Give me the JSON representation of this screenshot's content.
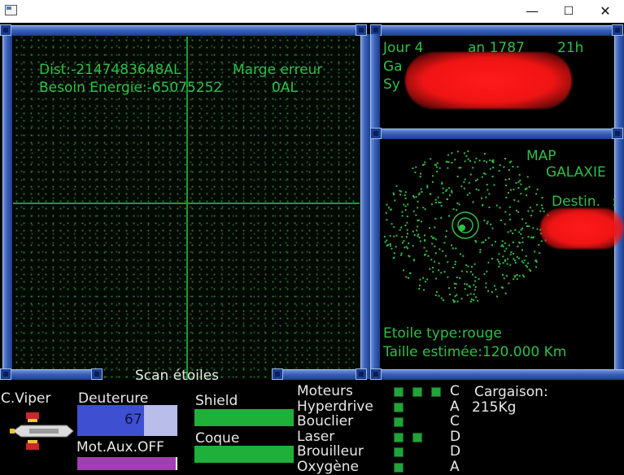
{
  "window": {
    "minimize_label": "—",
    "maximize_label": "☐",
    "close_label": "✕"
  },
  "scanner": {
    "dist_label": "Dist:-2147483648AL",
    "margin_label": "Marge erreur",
    "energy_label": "Besoin Energie:-65075252",
    "energy_unit": "0AL",
    "title": "Scan étoiles"
  },
  "info_panel": {
    "day_label": "Jour 4",
    "year_label": "an 1787",
    "hour_label": "21h",
    "galaxy_prefix": "Ga",
    "system_prefix": "Sy"
  },
  "map_panel": {
    "title_line1": "MAP",
    "title_line2": "GALAXIE",
    "destination_label": "Destin.",
    "destination_suffix": ":",
    "star_type_label": "Etoile type:rouge",
    "size_label": "Taille estimée:120.000 Km"
  },
  "ship": {
    "name": "C.Viper",
    "deuterium_label": "Deuterure",
    "deuterium_value": "67",
    "deuterium_fraction": 0.67,
    "aux_motor_label": "Mot.Aux.OFF",
    "shield_label": "Shield",
    "hull_label": "Coque"
  },
  "systems": [
    {
      "name": "Moteurs",
      "grade": "C",
      "pips": 3
    },
    {
      "name": "Hyperdrive",
      "grade": "A",
      "pips": 1
    },
    {
      "name": "Bouclier",
      "grade": "C",
      "pips": 1
    },
    {
      "name": "Laser",
      "grade": "D",
      "pips": 2
    },
    {
      "name": "Brouilleur",
      "grade": "D",
      "pips": 1
    },
    {
      "name": "Oxygène",
      "grade": "A",
      "pips": 1
    }
  ],
  "cargo": {
    "label": "Cargaison:",
    "value": "215Kg"
  },
  "colors": {
    "hud_green": "#2fbf46",
    "frame_blue": "#3a5fb8",
    "deuterium_fill": "#3e4fd2",
    "deuterium_empty": "#b9bdea",
    "aux_bar": "#a040b0"
  }
}
